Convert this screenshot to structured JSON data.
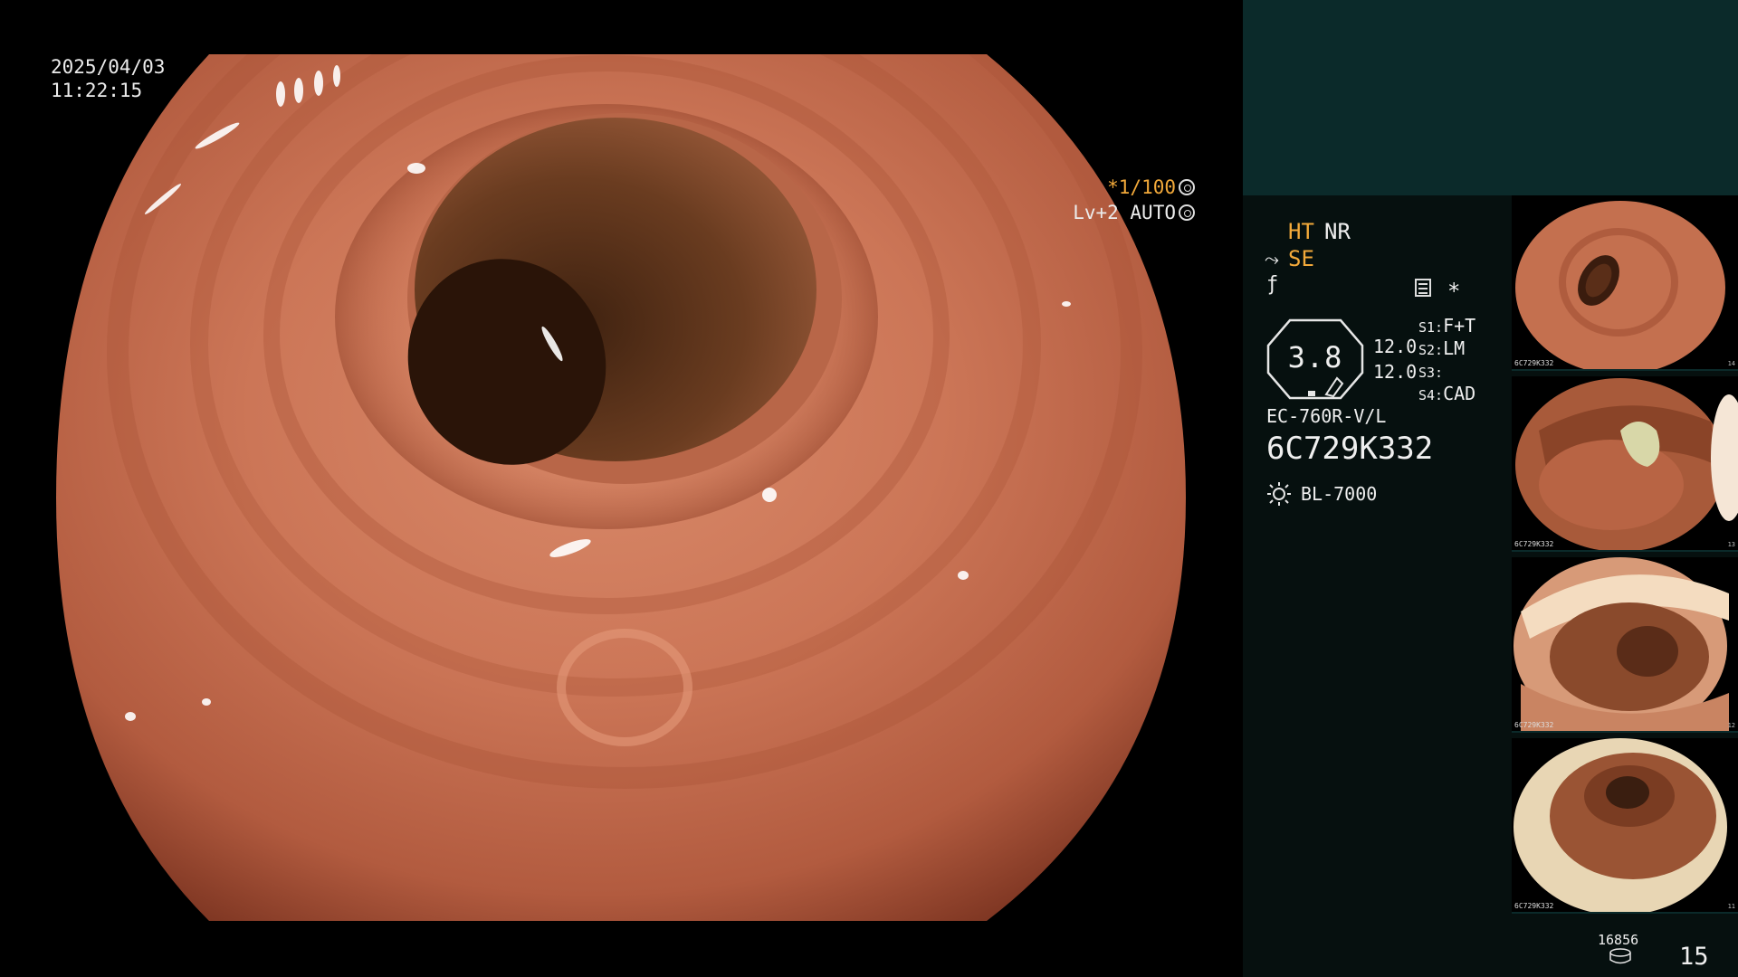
{
  "overlay": {
    "date": "2025/04/03",
    "time": "11:22:15",
    "shutter": "*1/100",
    "shutter_icon": "aperture-icon",
    "exposure": "Lv+2 AUTO",
    "exposure_icon": "auto-exposure-icon"
  },
  "panel": {
    "ht": "HT",
    "nr": "NR",
    "se": "SE",
    "se_icon": "structure-enhance-icon",
    "f_icon": "frequency-icon",
    "menu_icon": "menu-icon",
    "star": "*",
    "zoom": "3.8",
    "value1": "12.0",
    "value2": "12.0",
    "s1_label": "S1:",
    "s1_value": "F+T",
    "s2_label": "S2:",
    "s2_value": "LM",
    "s3_label": "S3:",
    "s3_value": "",
    "s4_label": "S4:",
    "s4_value": "CAD",
    "model": "EC-760R-V/L",
    "serial": "6C729K332",
    "light_source_icon": "lamp-icon",
    "light_source": "BL-7000"
  },
  "thumbnails": [
    {
      "id": "6C729K332",
      "no": "14"
    },
    {
      "id": "6C729K332",
      "no": "13"
    },
    {
      "id": "6C729K332",
      "no": "12"
    },
    {
      "id": "6C729K332",
      "no": "11"
    }
  ],
  "counter": {
    "total": "16856",
    "page": "15",
    "icon": "storage-icon"
  },
  "colors": {
    "accent": "#f2a93a",
    "panel_top": "#0b2a2a",
    "panel_bg": "#06100f"
  }
}
